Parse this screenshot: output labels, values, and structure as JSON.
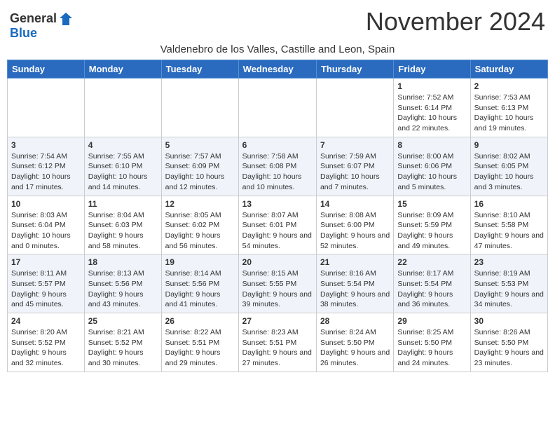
{
  "header": {
    "logo_general": "General",
    "logo_blue": "Blue",
    "month_title": "November 2024",
    "subtitle": "Valdenebro de los Valles, Castille and Leon, Spain"
  },
  "weekdays": [
    "Sunday",
    "Monday",
    "Tuesday",
    "Wednesday",
    "Thursday",
    "Friday",
    "Saturday"
  ],
  "weeks": [
    [
      {
        "day": "",
        "info": ""
      },
      {
        "day": "",
        "info": ""
      },
      {
        "day": "",
        "info": ""
      },
      {
        "day": "",
        "info": ""
      },
      {
        "day": "",
        "info": ""
      },
      {
        "day": "1",
        "info": "Sunrise: 7:52 AM\nSunset: 6:14 PM\nDaylight: 10 hours and 22 minutes."
      },
      {
        "day": "2",
        "info": "Sunrise: 7:53 AM\nSunset: 6:13 PM\nDaylight: 10 hours and 19 minutes."
      }
    ],
    [
      {
        "day": "3",
        "info": "Sunrise: 7:54 AM\nSunset: 6:12 PM\nDaylight: 10 hours and 17 minutes."
      },
      {
        "day": "4",
        "info": "Sunrise: 7:55 AM\nSunset: 6:10 PM\nDaylight: 10 hours and 14 minutes."
      },
      {
        "day": "5",
        "info": "Sunrise: 7:57 AM\nSunset: 6:09 PM\nDaylight: 10 hours and 12 minutes."
      },
      {
        "day": "6",
        "info": "Sunrise: 7:58 AM\nSunset: 6:08 PM\nDaylight: 10 hours and 10 minutes."
      },
      {
        "day": "7",
        "info": "Sunrise: 7:59 AM\nSunset: 6:07 PM\nDaylight: 10 hours and 7 minutes."
      },
      {
        "day": "8",
        "info": "Sunrise: 8:00 AM\nSunset: 6:06 PM\nDaylight: 10 hours and 5 minutes."
      },
      {
        "day": "9",
        "info": "Sunrise: 8:02 AM\nSunset: 6:05 PM\nDaylight: 10 hours and 3 minutes."
      }
    ],
    [
      {
        "day": "10",
        "info": "Sunrise: 8:03 AM\nSunset: 6:04 PM\nDaylight: 10 hours and 0 minutes."
      },
      {
        "day": "11",
        "info": "Sunrise: 8:04 AM\nSunset: 6:03 PM\nDaylight: 9 hours and 58 minutes."
      },
      {
        "day": "12",
        "info": "Sunrise: 8:05 AM\nSunset: 6:02 PM\nDaylight: 9 hours and 56 minutes."
      },
      {
        "day": "13",
        "info": "Sunrise: 8:07 AM\nSunset: 6:01 PM\nDaylight: 9 hours and 54 minutes."
      },
      {
        "day": "14",
        "info": "Sunrise: 8:08 AM\nSunset: 6:00 PM\nDaylight: 9 hours and 52 minutes."
      },
      {
        "day": "15",
        "info": "Sunrise: 8:09 AM\nSunset: 5:59 PM\nDaylight: 9 hours and 49 minutes."
      },
      {
        "day": "16",
        "info": "Sunrise: 8:10 AM\nSunset: 5:58 PM\nDaylight: 9 hours and 47 minutes."
      }
    ],
    [
      {
        "day": "17",
        "info": "Sunrise: 8:11 AM\nSunset: 5:57 PM\nDaylight: 9 hours and 45 minutes."
      },
      {
        "day": "18",
        "info": "Sunrise: 8:13 AM\nSunset: 5:56 PM\nDaylight: 9 hours and 43 minutes."
      },
      {
        "day": "19",
        "info": "Sunrise: 8:14 AM\nSunset: 5:56 PM\nDaylight: 9 hours and 41 minutes."
      },
      {
        "day": "20",
        "info": "Sunrise: 8:15 AM\nSunset: 5:55 PM\nDaylight: 9 hours and 39 minutes."
      },
      {
        "day": "21",
        "info": "Sunrise: 8:16 AM\nSunset: 5:54 PM\nDaylight: 9 hours and 38 minutes."
      },
      {
        "day": "22",
        "info": "Sunrise: 8:17 AM\nSunset: 5:54 PM\nDaylight: 9 hours and 36 minutes."
      },
      {
        "day": "23",
        "info": "Sunrise: 8:19 AM\nSunset: 5:53 PM\nDaylight: 9 hours and 34 minutes."
      }
    ],
    [
      {
        "day": "24",
        "info": "Sunrise: 8:20 AM\nSunset: 5:52 PM\nDaylight: 9 hours and 32 minutes."
      },
      {
        "day": "25",
        "info": "Sunrise: 8:21 AM\nSunset: 5:52 PM\nDaylight: 9 hours and 30 minutes."
      },
      {
        "day": "26",
        "info": "Sunrise: 8:22 AM\nSunset: 5:51 PM\nDaylight: 9 hours and 29 minutes."
      },
      {
        "day": "27",
        "info": "Sunrise: 8:23 AM\nSunset: 5:51 PM\nDaylight: 9 hours and 27 minutes."
      },
      {
        "day": "28",
        "info": "Sunrise: 8:24 AM\nSunset: 5:50 PM\nDaylight: 9 hours and 26 minutes."
      },
      {
        "day": "29",
        "info": "Sunrise: 8:25 AM\nSunset: 5:50 PM\nDaylight: 9 hours and 24 minutes."
      },
      {
        "day": "30",
        "info": "Sunrise: 8:26 AM\nSunset: 5:50 PM\nDaylight: 9 hours and 23 minutes."
      }
    ]
  ]
}
